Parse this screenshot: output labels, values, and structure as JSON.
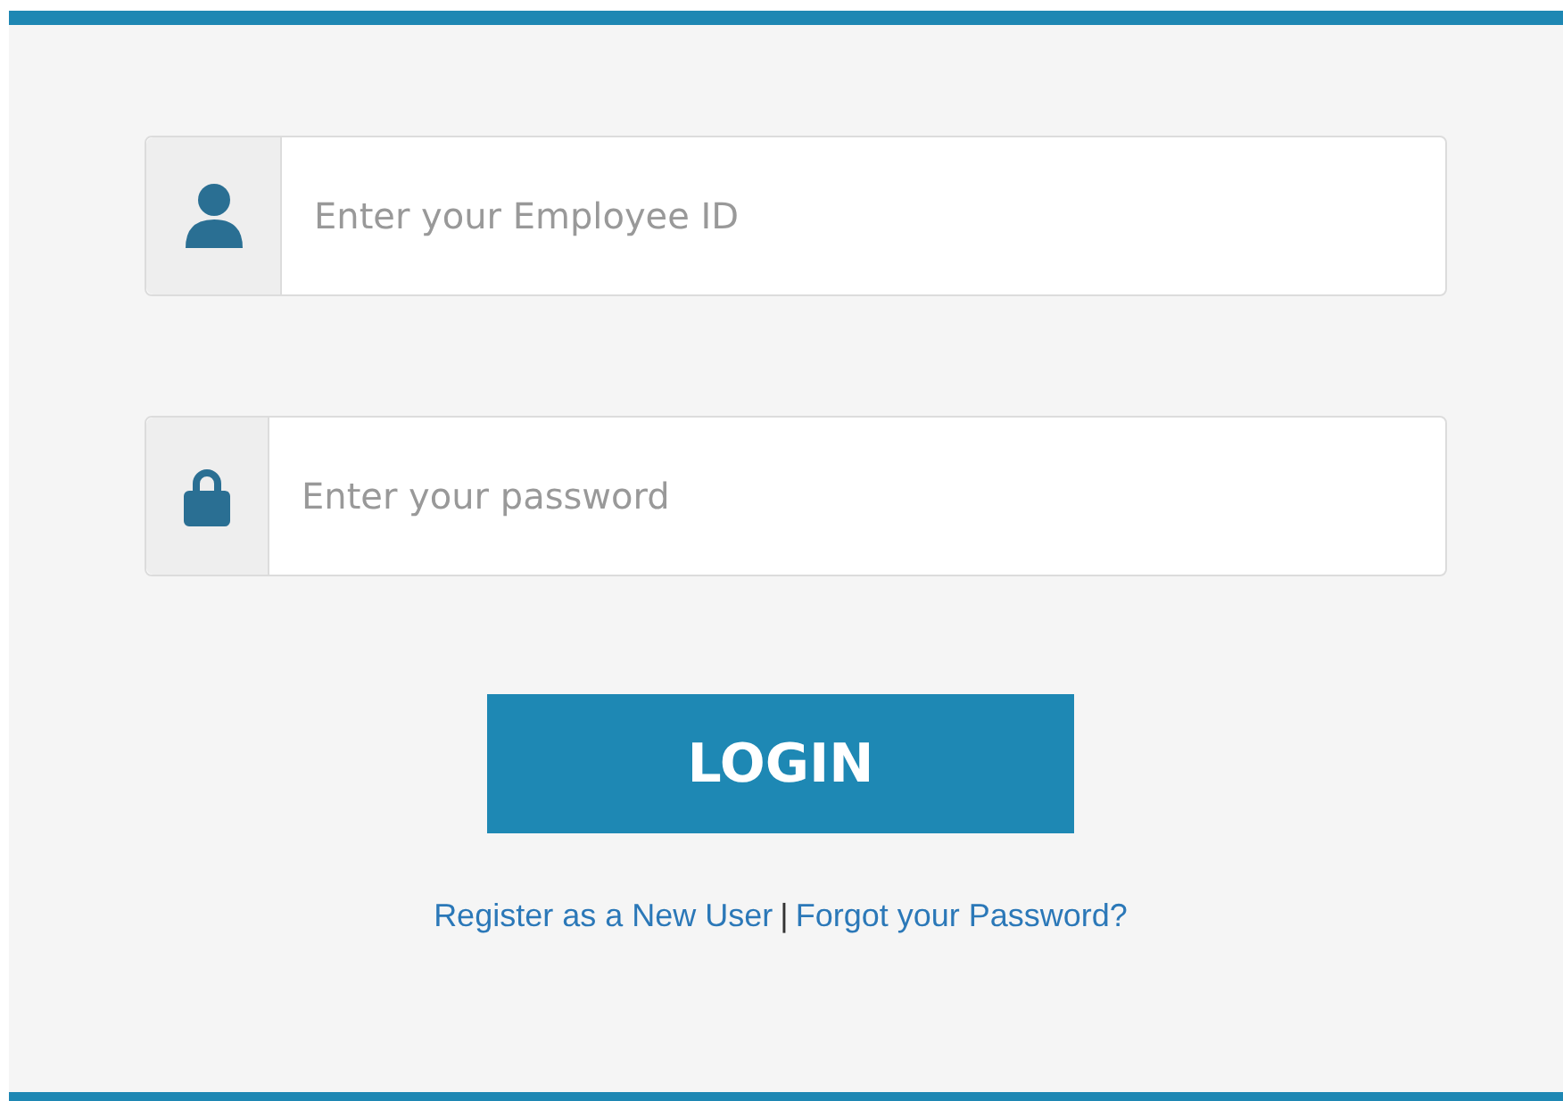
{
  "fields": [
    {
      "kind": "user",
      "placeholder": "Enter your Employee ID"
    },
    {
      "kind": "password",
      "placeholder": "Enter your password"
    }
  ],
  "login_button": "LOGIN",
  "links": [
    {
      "label": "Register as a New User"
    },
    {
      "label": "Forgot your Password?"
    }
  ],
  "separator": "|"
}
